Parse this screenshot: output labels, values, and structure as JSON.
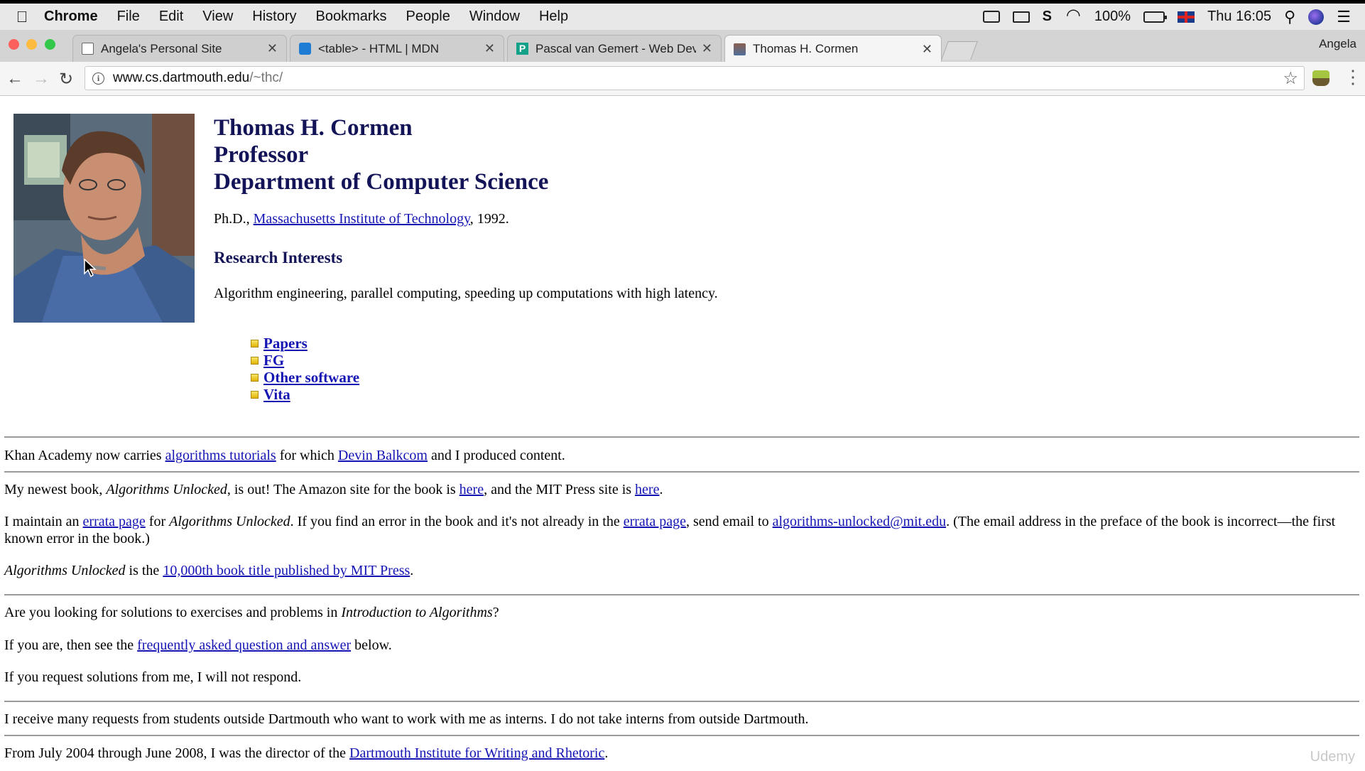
{
  "menubar": {
    "app": "Chrome",
    "items": [
      "File",
      "Edit",
      "View",
      "History",
      "Bookmarks",
      "People",
      "Window",
      "Help"
    ],
    "battery": "100%",
    "clock": "Thu 16:05"
  },
  "tabs": [
    {
      "title": "Angela's Personal Site"
    },
    {
      "title": "<table> - HTML | MDN"
    },
    {
      "title": "Pascal van Gemert - Web Deve"
    },
    {
      "title": "Thomas H. Cormen"
    }
  ],
  "profile_name": "Angela",
  "address": {
    "host": "www.cs.dartmouth.edu",
    "path": "/~thc/"
  },
  "page": {
    "name": "Thomas H. Cormen",
    "title": "Professor",
    "department": "Department of Computer Science",
    "phd_prefix": "Ph.D., ",
    "phd_link": "Massachusetts Institute of Technology",
    "phd_suffix": ", 1992.",
    "research_heading": "Research Interests",
    "research_text": "Algorithm engineering, parallel computing, speeding up computations with high latency.",
    "links": [
      "Papers",
      "FG",
      "Other software",
      "Vita"
    ],
    "khan": {
      "t1": "Khan Academy now carries ",
      "l1": "algorithms tutorials",
      "t2": " for which ",
      "l2": "Devin Balkcom",
      "t3": " and I produced content."
    },
    "book": {
      "t1": "My newest book, ",
      "i1": "Algorithms Unlocked",
      "t2": ", is out! The Amazon site for the book is ",
      "l1": "here",
      "t3": ", and the MIT Press site is ",
      "l2": "here",
      "t4": "."
    },
    "errata": {
      "t1": "I maintain an ",
      "l1": "errata page",
      "t2": " for ",
      "i1": "Algorithms Unlocked",
      "t3": ". If you find an error in the book and it's not already in the ",
      "l2": "errata page",
      "t4": ", send email to ",
      "l3": "algorithms-unlocked@mit.edu",
      "t5": ". (The email address in the preface of the book is incorrect—the first known error in the book.)"
    },
    "milestone": {
      "i1": "Algorithms Unlocked",
      "t1": " is the ",
      "l1": "10,000th book title published by MIT Press",
      "t2": "."
    },
    "solutions": {
      "t1": "Are you looking for solutions to exercises and problems in ",
      "i1": "Introduction to Algorithms",
      "t2": "?"
    },
    "faq": {
      "t1": "If you are, then see the ",
      "l1": "frequently asked question and answer",
      "t2": " below."
    },
    "no_response": "If you request solutions from me, I will not respond.",
    "interns": "I receive many requests from students outside Dartmouth who want to work with me as interns. I do not take interns from outside Dartmouth.",
    "director": {
      "t1": "From July 2004 through June 2008, I was the director of the ",
      "l1": "Dartmouth Institute for Writing and Rhetoric",
      "t2": "."
    }
  },
  "watermark": "Udemy"
}
